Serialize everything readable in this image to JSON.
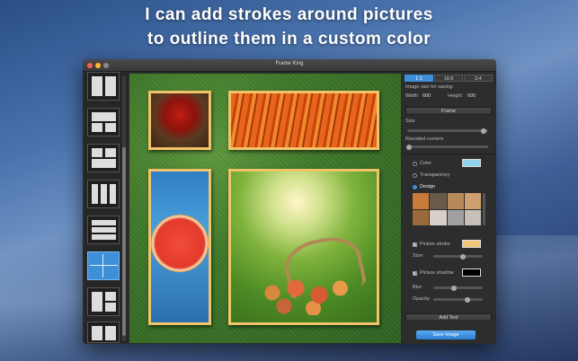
{
  "headline": {
    "line1": "I can add strokes around pictures",
    "line2": "to outline them in a custom color"
  },
  "window": {
    "title": "Frame King"
  },
  "ratio_tabs": [
    "1:1",
    "16:9",
    "3:4"
  ],
  "size": {
    "label": "Image size for saving:",
    "width_label": "Width",
    "width_value": "600",
    "height_label": "Height",
    "height_value": "600"
  },
  "frame": {
    "header": "Frame",
    "size_label": "Size",
    "rounded_label": "Rounded corners"
  },
  "background": {
    "color_label": "Color",
    "transparency_label": "Transparency",
    "design_label": "Design",
    "color_value": "#8fd3e8"
  },
  "stroke": {
    "label": "Picture stroke",
    "size_label": "Size:",
    "color": "#f3c77a"
  },
  "shadow": {
    "label": "Picture shadow",
    "blur_label": "Blur:",
    "opacity_label": "Opacity:",
    "color": "#000000"
  },
  "buttons": {
    "add_text": "Add Text",
    "save_image": "Save Image"
  }
}
